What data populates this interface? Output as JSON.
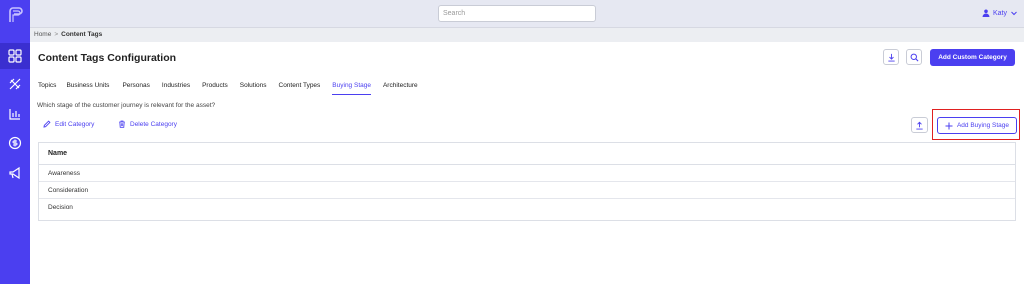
{
  "topbar": {
    "search_placeholder": "Search",
    "user_name": "Katy"
  },
  "breadcrumb": {
    "home": "Home",
    "separator": ">",
    "current": "Content Tags"
  },
  "page": {
    "title": "Content Tags Configuration",
    "add_custom_label": "Add Custom Category"
  },
  "tabs": [
    {
      "label": "Topics"
    },
    {
      "label": "Business Units"
    },
    {
      "label": "Personas"
    },
    {
      "label": "Industries"
    },
    {
      "label": "Products"
    },
    {
      "label": "Solutions"
    },
    {
      "label": "Content Types"
    },
    {
      "label": "Buying Stage"
    },
    {
      "label": "Architecture"
    }
  ],
  "active_tab": "Buying Stage",
  "description": "Which stage of the customer journey is relevant for the asset?",
  "actions": {
    "edit_label": "Edit Category",
    "delete_label": "Delete Category",
    "add_label": "Add Buying Stage"
  },
  "table": {
    "header": "Name",
    "rows": [
      "Awareness",
      "Consideration",
      "Decision"
    ]
  },
  "colors": {
    "accent": "#4b3ff0",
    "highlight": "#e02020"
  },
  "icons": [
    "logo-icon",
    "dashboard-icon",
    "tags-icon",
    "analytics-icon",
    "dollar-icon",
    "megaphone-icon",
    "user-icon",
    "chevron-down-icon",
    "download-icon",
    "search-icon",
    "edit-icon",
    "trash-icon",
    "upload-icon",
    "plus-icon"
  ]
}
